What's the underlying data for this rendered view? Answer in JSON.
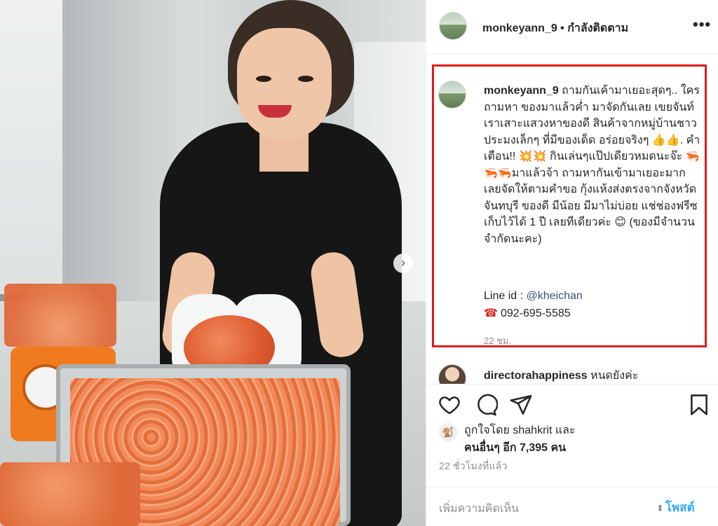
{
  "post": {
    "username": "monkeyann_9",
    "follow_status": "• กำลังติดตาม",
    "more_icon": "more-horizontal-icon",
    "photo_next_icon": "chevron-right-icon"
  },
  "caption": {
    "username": "monkeyann_9",
    "text": "ถามกันเค้ามาเยอะสุดๆ.. ใครถามหา ของมาแล้วค่ำ มาจัดกันเลย เขยจันท์เราเสาะแสวงหาของดี สินค้าจากหมู่บ้านชาวประมงเล็กๆ ที่มีของเด็ด อร่อยจริงๆ 👍👍. คำเตือน!! 💥💥 กินเล่นๆแป๊ปเดียวหมดนะจ๊ะ 🦐🦐🦐มาแล้วจ้า ถามหากันเข้ามาเยอะมาก เลยจัดให้ตามคำขอ กุ้งแห้งส่งตรงจากจังหวัดจันทบุรี ของดี มีน้อย มีมาไม่บ่อย แช่ช่องฟรีซเก็บไว้ได้ 1 ปี เลยทีเดียวค่ะ 😊 (ของมีจำนวนจำกัดนะคะ)",
    "line_label": "Line id : ",
    "line_handle": "@kheichan",
    "phone_icon": "☎",
    "phone": "092-695-5585",
    "time_ago": "22 ชม."
  },
  "next_comment": {
    "username": "directorahappiness",
    "text": " หนดยังค่ะ"
  },
  "actions": {
    "like_icon": "heart-icon",
    "comment_icon": "comment-icon",
    "share_icon": "send-icon",
    "save_icon": "bookmark-icon"
  },
  "likes": {
    "line1": "ถูกใจโดย shahkrit และ",
    "line2": "คนอื่นๆ อีก 7,395 คน"
  },
  "posted_ago": "22 ชั่วโมงที่แล้ว",
  "add_comment": {
    "placeholder": "เพิ่มความคิดเห็น",
    "post_label": "โพสต์"
  },
  "colors": {
    "highlight_border": "#e01b1b",
    "link": "#385185",
    "post_button": "#0095f6"
  }
}
